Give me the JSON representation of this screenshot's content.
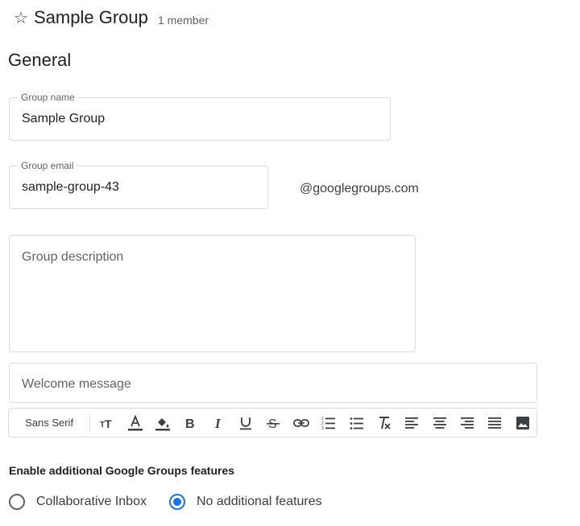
{
  "header": {
    "title": "Sample Group",
    "member_count": "1 member",
    "star_icon": "star-outline-icon"
  },
  "section": {
    "title": "General"
  },
  "group_name": {
    "label": "Group name",
    "value": "Sample Group"
  },
  "group_email": {
    "label": "Group email",
    "value": "sample-group-43",
    "suffix": "@googlegroups.com"
  },
  "group_description": {
    "placeholder": "Group description"
  },
  "welcome_message": {
    "placeholder": "Welcome message"
  },
  "toolbar": {
    "font": "Sans Serif",
    "icons": [
      "font-size-icon",
      "text-color-icon",
      "highlight-color-icon",
      "bold-icon",
      "italic-icon",
      "underline-icon",
      "strikethrough-icon",
      "link-icon",
      "numbered-list-icon",
      "bulleted-list-icon",
      "clear-formatting-icon",
      "align-left-icon",
      "align-center-icon",
      "align-right-icon",
      "justify-icon",
      "insert-image-icon"
    ],
    "accent": "#1a73e8"
  },
  "features": {
    "label": "Enable additional Google Groups features",
    "options": [
      {
        "label": "Collaborative Inbox",
        "selected": false
      },
      {
        "label": "No additional features",
        "selected": true
      }
    ]
  },
  "colors": {
    "accent": "#1a73e8",
    "border": "#dadce0",
    "text": "#202124",
    "muted": "#5f6368"
  }
}
